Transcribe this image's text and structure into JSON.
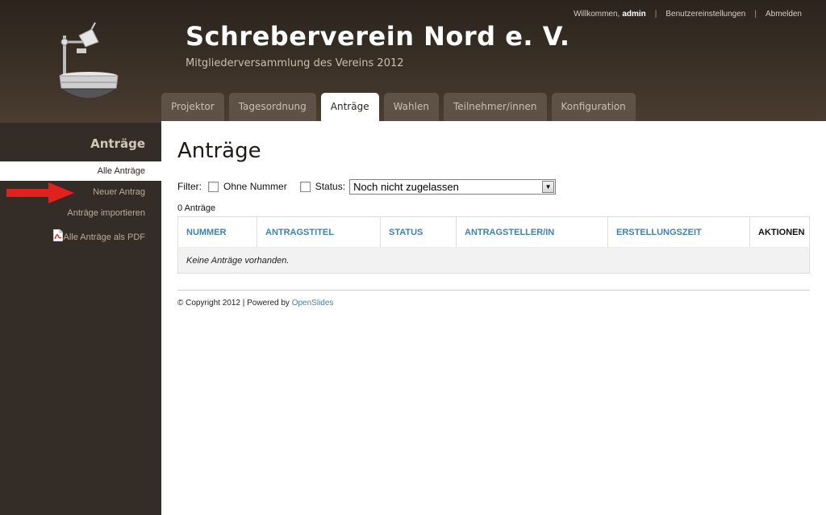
{
  "header": {
    "title": "Schreberverein Nord e. V.",
    "subtitle": "Mitgliederversammlung des Vereins 2012",
    "welcome": "Willkommen,",
    "username": "admin",
    "separator": "|",
    "user_settings": "Benutzereinstellungen",
    "logout": "Abmelden"
  },
  "tabs": [
    {
      "label": "Projektor"
    },
    {
      "label": "Tagesordnung"
    },
    {
      "label": "Anträge"
    },
    {
      "label": "Wahlen"
    },
    {
      "label": "Teilnehmer/innen"
    },
    {
      "label": "Konfiguration"
    }
  ],
  "sidebar": {
    "title": "Anträge",
    "items": [
      {
        "label": "Alle Anträge"
      },
      {
        "label": "Neuer Antrag"
      },
      {
        "label": "Anträge importieren"
      },
      {
        "label": "Alle Anträge als PDF",
        "icon": "pdf-icon"
      }
    ]
  },
  "main": {
    "title": "Anträge",
    "filter_label": "Filter:",
    "no_number_label": "Ohne Nummer",
    "status_label": "Status:",
    "status_value": "Noch nicht zugelassen",
    "count": "0 Anträge",
    "table": {
      "columns": [
        "NUMMER",
        "ANTRAGSTITEL",
        "STATUS",
        "ANTRAGSTELLER/IN",
        "ERSTELLUNGSZEIT",
        "AKTIONEN"
      ],
      "empty_message": "Keine Anträge vorhanden."
    },
    "footer": {
      "copyright": "© Copyright 2012 | Powered by",
      "powered_link": "OpenSlides"
    }
  },
  "colors": {
    "header_bg": "#3a3026",
    "sidebar_bg": "#342c27",
    "link_blue": "#3f82b0",
    "annotation_red": "#e0221f"
  }
}
